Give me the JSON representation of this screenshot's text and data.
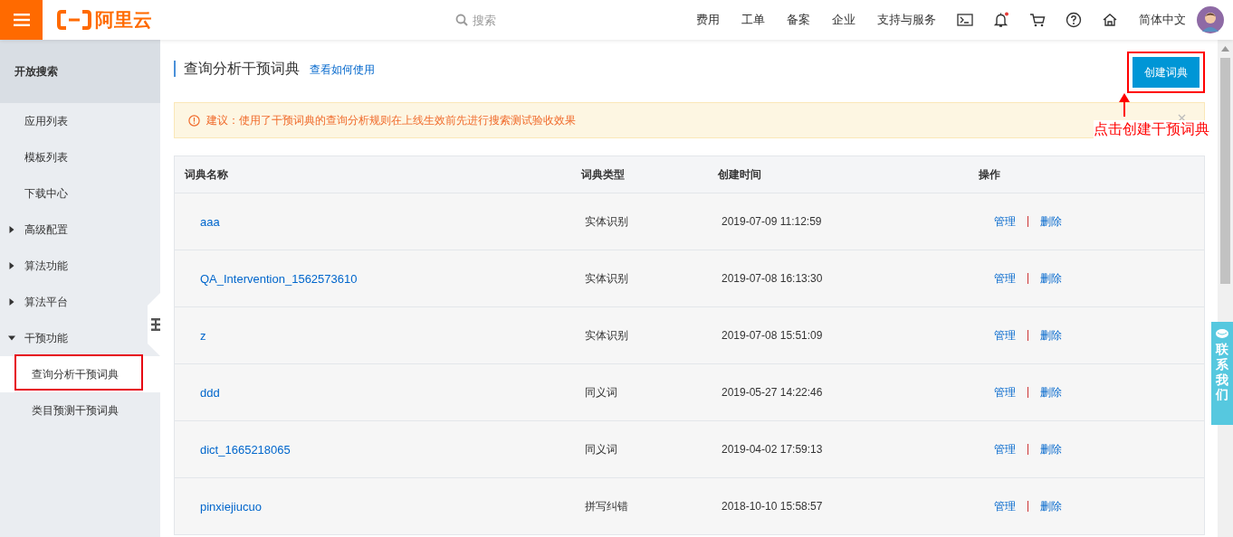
{
  "topbar": {
    "logo_text": "阿里云",
    "search_placeholder": "搜索",
    "nav": [
      "费用",
      "工单",
      "备案",
      "企业",
      "支持与服务"
    ],
    "notification_dot": true,
    "language": "简体中文"
  },
  "sidebar": {
    "title": "开放搜索",
    "items": [
      {
        "label": "应用列表",
        "kind": "link",
        "selected": false
      },
      {
        "label": "模板列表",
        "kind": "link",
        "selected": false
      },
      {
        "label": "下载中心",
        "kind": "link",
        "selected": false
      },
      {
        "label": "高级配置",
        "kind": "group",
        "expanded": false
      },
      {
        "label": "算法功能",
        "kind": "group",
        "expanded": false
      },
      {
        "label": "算法平台",
        "kind": "group",
        "expanded": false
      },
      {
        "label": "干预功能",
        "kind": "group",
        "expanded": true,
        "children": [
          {
            "label": "查询分析干预词典",
            "selected": true,
            "highlighted": true
          },
          {
            "label": "类目预测干预词典",
            "selected": false,
            "highlighted": false
          }
        ]
      }
    ]
  },
  "page": {
    "title": "查询分析干预词典",
    "help_link": "查看如何使用",
    "create_button": "创建词典",
    "create_button_highlighted": true,
    "annotation": "点击创建干预词典",
    "alert": "建议：使用了干预词典的查询分析规则在上线生效前先进行搜索测试验收效果"
  },
  "table": {
    "columns": [
      "词典名称",
      "词典类型",
      "创建时间",
      "操作"
    ],
    "rows": [
      {
        "name": "aaa",
        "type": "实体识别",
        "created": "2019-07-09 11:12:59",
        "actions": [
          "管理",
          "删除"
        ]
      },
      {
        "name": "QA_Intervention_1562573610",
        "type": "实体识别",
        "created": "2019-07-08 16:13:30",
        "actions": [
          "管理",
          "删除"
        ]
      },
      {
        "name": "z",
        "type": "实体识别",
        "created": "2019-07-08 15:51:09",
        "actions": [
          "管理",
          "删除"
        ]
      },
      {
        "name": "ddd",
        "type": "同义词",
        "created": "2019-05-27 14:22:46",
        "actions": [
          "管理",
          "删除"
        ]
      },
      {
        "name": "dict_1665218065",
        "type": "同义词",
        "created": "2019-04-02 17:59:13",
        "actions": [
          "管理",
          "删除"
        ]
      },
      {
        "name": "pinxiejiucuo",
        "type": "拼写纠错",
        "created": "2018-10-10 15:58:57",
        "actions": [
          "管理",
          "删除"
        ]
      }
    ]
  },
  "contact_tab": "联系我们"
}
